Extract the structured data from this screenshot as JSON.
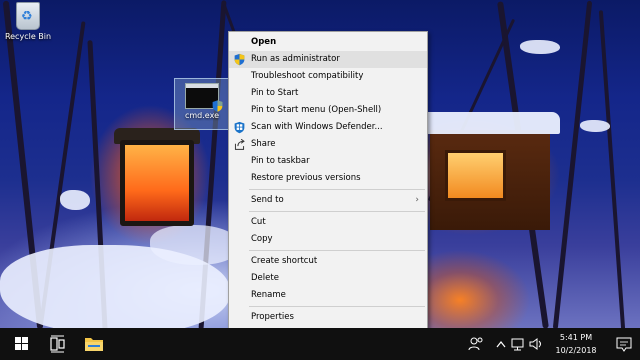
{
  "desktop": {
    "icons": [
      {
        "label": "Recycle Bin",
        "icon": "recycle-bin-icon"
      },
      {
        "label": "cmd.exe",
        "icon": "command-prompt-icon"
      }
    ]
  },
  "context_menu": {
    "items": [
      {
        "label": "Open",
        "bold": true
      },
      {
        "label": "Run as administrator",
        "icon": "uac-shield-icon",
        "highlighted": true
      },
      {
        "label": "Troubleshoot compatibility"
      },
      {
        "label": "Pin to Start"
      },
      {
        "label": "Pin to Start menu (Open-Shell)"
      },
      {
        "label": "Scan with Windows Defender...",
        "icon": "windows-defender-icon"
      },
      {
        "label": "Share",
        "icon": "share-icon"
      },
      {
        "label": "Pin to taskbar"
      },
      {
        "label": "Restore previous versions"
      },
      {
        "label": "Send to",
        "submenu": true
      },
      {
        "label": "Cut"
      },
      {
        "label": "Copy"
      },
      {
        "label": "Create shortcut"
      },
      {
        "label": "Delete"
      },
      {
        "label": "Rename"
      },
      {
        "label": "Properties"
      }
    ]
  },
  "taskbar": {
    "time": "5:41 PM",
    "date": "10/2/2018"
  },
  "colors": {
    "menu_bg": "#f2f2f2",
    "menu_highlight": "#e0e0e0",
    "taskbar_bg": "#101010",
    "accent": "#2f7fd8"
  }
}
